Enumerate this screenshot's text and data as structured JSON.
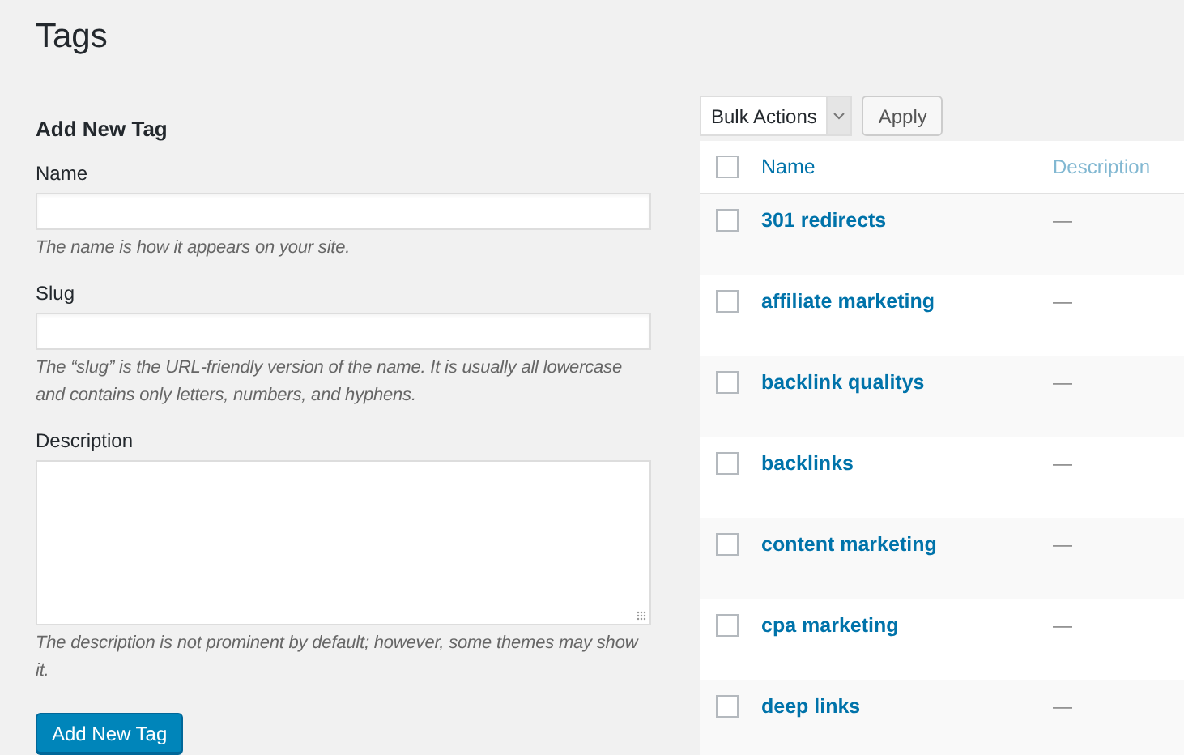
{
  "page_title": "Tags",
  "form": {
    "heading": "Add New Tag",
    "fields": [
      {
        "kind": "input",
        "label": "Name",
        "hint": "The name is how it appears on your site."
      },
      {
        "kind": "input",
        "label": "Slug",
        "hint": "The “slug” is the URL-friendly version of the name. It is usually all lowercase and contains only letters, numbers, and hyphens."
      },
      {
        "kind": "textarea",
        "label": "Description",
        "hint": "The description is not prominent by default; however, some themes may show it."
      }
    ],
    "submit": "Add New Tag"
  },
  "bulk": {
    "select": "Bulk Actions",
    "apply": "Apply"
  },
  "table": {
    "select_all": {
      "checked": false
    },
    "columns": [
      "Name",
      "Description"
    ],
    "rows": [
      {
        "name": "301 redirects",
        "description": "—",
        "checked": false
      },
      {
        "name": "affiliate marketing",
        "description": "—",
        "checked": false
      },
      {
        "name": "backlink qualitys",
        "description": "—",
        "checked": false
      },
      {
        "name": "backlinks",
        "description": "—",
        "checked": false
      },
      {
        "name": "content marketing",
        "description": "—",
        "checked": false
      },
      {
        "name": "cpa marketing",
        "description": "—",
        "checked": false
      },
      {
        "name": "deep links",
        "description": "—",
        "checked": false
      }
    ]
  }
}
